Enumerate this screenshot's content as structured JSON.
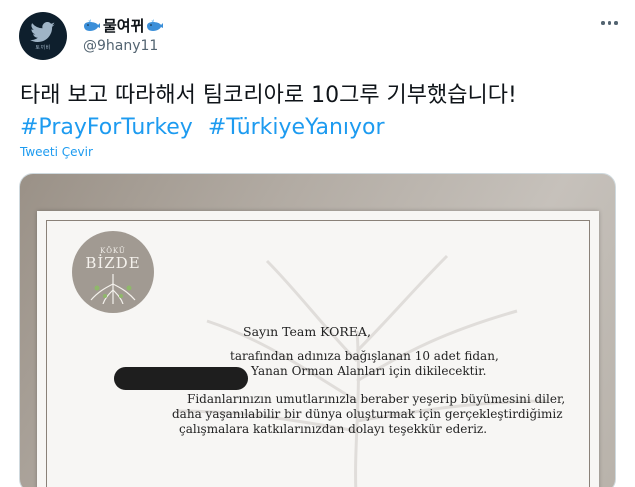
{
  "tweet": {
    "display_name": "물여뀌",
    "handle": "@9hany11",
    "avatar_text": "토끼비",
    "text": "타래 보고 따라해서 팀코리아로 10그루 기부했습니다!",
    "hashtags": [
      "#PrayForTurkey",
      "#TürkiyeYanıyor"
    ],
    "translate_label": "Tweeti Çevir"
  },
  "certificate": {
    "logo_top": "KÖKÜ",
    "logo_main": "BİZDE",
    "greeting": "Sayın Team KOREA,",
    "line1": "tarafından adınıza bağışlanan 10 adet fidan,",
    "line2": "Yanan Orman Alanları için dikilecektir.",
    "line3": "Fidanlarınızın umutlarınızla beraber yeşerip büyümesini diler,",
    "line4": "daha yaşanılabilir bir dünya oluşturmak için gerçekleştirdiğimiz",
    "line5": "çalışmalara katkılarınızdan dolayı teşekkür ederiz."
  },
  "colors": {
    "link": "#1d9bf0",
    "secondary_text": "#536471",
    "redaction": "#1e1e1e"
  },
  "icons": {
    "avatar": "bird-logo-icon",
    "name_decoration": "whale-emoji-icon",
    "menu": "more-options-icon"
  }
}
